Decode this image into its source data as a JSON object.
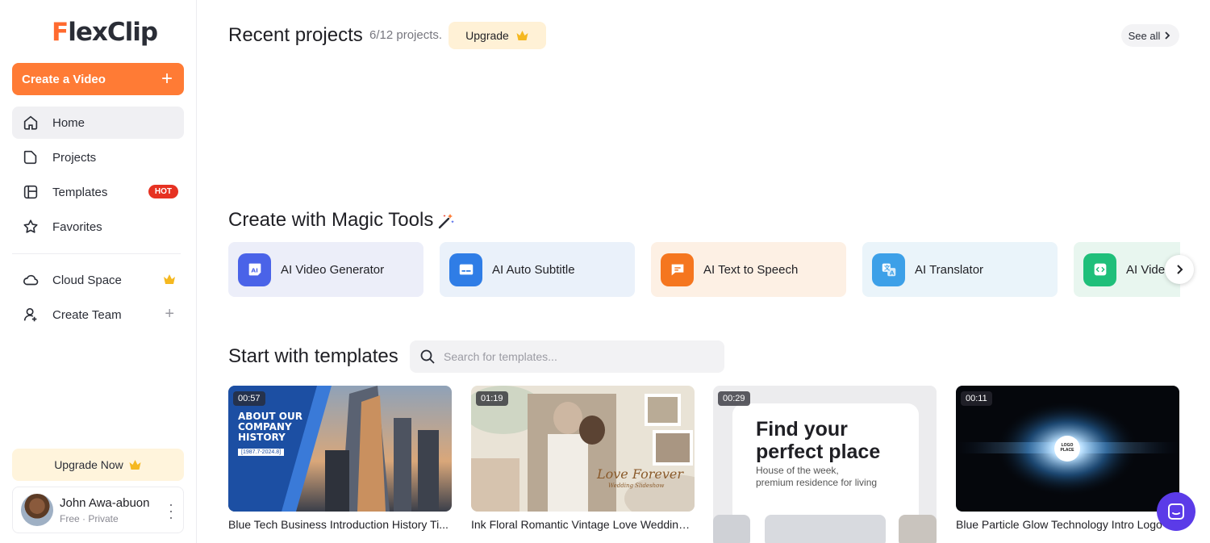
{
  "brand": {
    "logo_f": "F",
    "logo_rest": "lexClip"
  },
  "sidebar": {
    "create_label": "Create a Video",
    "create_plus": "+",
    "items": [
      {
        "label": "Home",
        "icon": "home-icon"
      },
      {
        "label": "Projects",
        "icon": "folder-icon"
      },
      {
        "label": "Templates",
        "icon": "templates-icon",
        "badge": "HOT"
      },
      {
        "label": "Favorites",
        "icon": "star-icon"
      },
      {
        "label": "Cloud Space",
        "icon": "cloud-icon"
      },
      {
        "label": "Create Team",
        "icon": "add-user-icon",
        "plus": "+"
      }
    ],
    "upgrade_now": "Upgrade Now",
    "user": {
      "name": "John Awa-abuon",
      "plan": "Free · Private"
    }
  },
  "recent": {
    "title": "Recent projects",
    "count": "6/12 projects.",
    "upgrade": "Upgrade",
    "see_all": "See all"
  },
  "magic": {
    "title": "Create with Magic Tools",
    "tools": [
      {
        "label": "AI Video Generator",
        "bg": "#eceef9",
        "icon_bg": "#4a63e8"
      },
      {
        "label": "AI Auto Subtitle",
        "bg": "#eaf1fa",
        "icon_bg": "#2f7de6"
      },
      {
        "label": "AI Text to Speech",
        "bg": "#fdf0e4",
        "icon_bg": "#f5761f"
      },
      {
        "label": "AI Translator",
        "bg": "#eaf4fa",
        "icon_bg": "#3da0e8"
      },
      {
        "label": "AI Video",
        "bg": "#e8f6ef",
        "icon_bg": "#1fbf7a"
      }
    ]
  },
  "templates": {
    "title": "Start with templates",
    "search_placeholder": "Search for templates...",
    "items": [
      {
        "duration": "00:57",
        "title": "Blue Tech Business Introduction History Ti..."
      },
      {
        "duration": "01:19",
        "title": "Ink Floral Romantic Vintage Love Wedding A..."
      },
      {
        "duration": "00:29",
        "title": ""
      },
      {
        "duration": "00:11",
        "title": "Blue Particle Glow Technology Intro Logo"
      }
    ],
    "thumb1_text": [
      "ABOUT OUR",
      "COMPANY",
      "HISTORY"
    ],
    "thumb1_date": "[1987.7-2024.8]",
    "thumb2_text": "Love Forever",
    "thumb2_sub": "Wedding Slideshow",
    "thumb3_heading1": "Find your",
    "thumb3_heading2": "perfect place",
    "thumb3_sub1": "House of the week,",
    "thumb3_sub2": "premium residence for living",
    "thumb4_logo1": "LOGO",
    "thumb4_logo2": "PLACE"
  },
  "colors": {
    "accent": "#ff7b35",
    "hot": "#e63222",
    "chat": "#5b3be8"
  }
}
